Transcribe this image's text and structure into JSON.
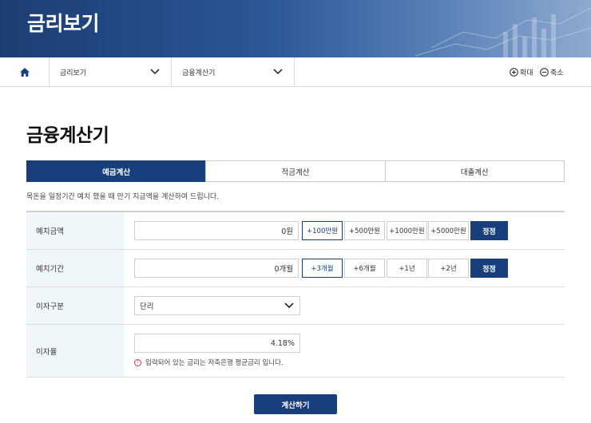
{
  "banner": {
    "title": "금리보기"
  },
  "breadcrumb": {
    "level1": "금리보기",
    "level2": "금융계산기",
    "zoom_in": "확대",
    "zoom_out": "축소"
  },
  "page": {
    "title": "금융계산기",
    "description": "목돈을 일정기간 예치 했을 때 만기 지금액을 계산하여 드립니다."
  },
  "tabs": [
    {
      "label": "예금계산",
      "active": true
    },
    {
      "label": "적금계산",
      "active": false
    },
    {
      "label": "대출계산",
      "active": false
    }
  ],
  "form": {
    "amount": {
      "label": "예치금액",
      "value": "0원",
      "quick": [
        "+100만원",
        "+500만원",
        "+1000만원",
        "+5000만원"
      ],
      "fix": "정정"
    },
    "period": {
      "label": "예치기간",
      "value": "0개월",
      "quick": [
        "+3개월",
        "+6개월",
        "+1년",
        "+2년"
      ],
      "fix": "정정"
    },
    "interest_type": {
      "label": "이자구분",
      "selected": "단리"
    },
    "rate": {
      "label": "이자율",
      "value": "4.18%",
      "note": "입력되어 있는 금리는 저축은행 평균금리 입니다."
    }
  },
  "submit": {
    "label": "계산하기"
  },
  "colors": {
    "primary": "#183e7c",
    "label_bg": "#f1f6f9",
    "note_icon": "#d23a3a"
  }
}
